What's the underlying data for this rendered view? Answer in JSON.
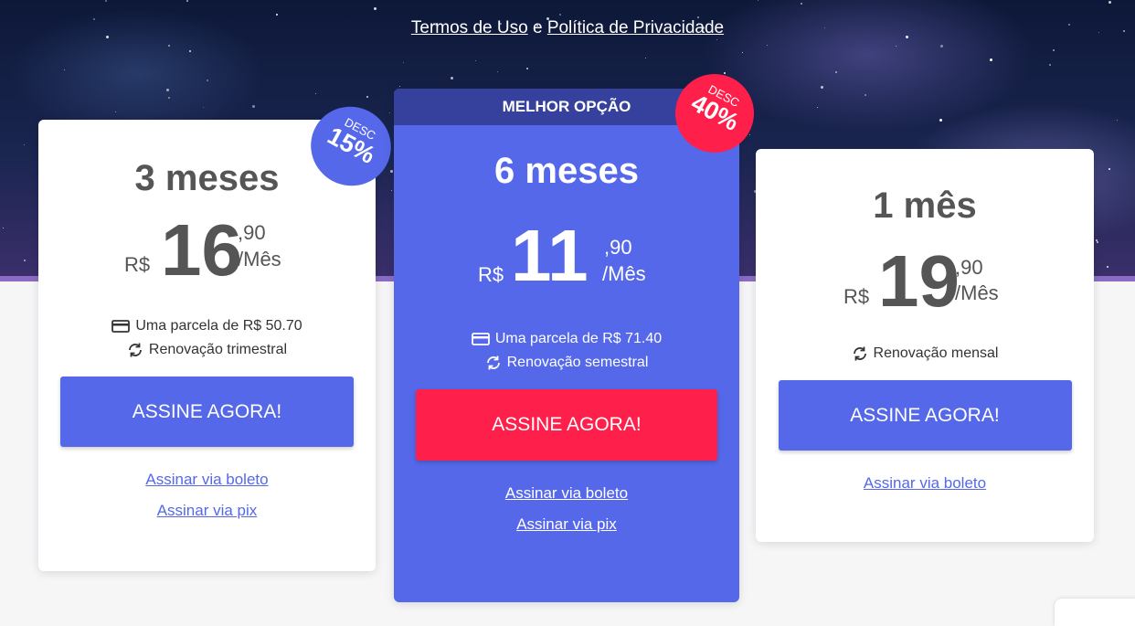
{
  "terms": {
    "terms_link": "Termos de Uso",
    "and": "e",
    "privacy_link": "Política de Privacidade"
  },
  "plans": [
    {
      "months": "3 meses",
      "currency": "R$",
      "integer": "16",
      "cents": ",90",
      "per": "/Mês",
      "installment": "Uma parcela de R$ 50.70",
      "renewal": "Renovação trimestral",
      "cta": "ASSINE AGORA!",
      "boleto": "Assinar via boleto",
      "pix": "Assinar via pix",
      "badge_label": "DESC",
      "badge_percent": "15%"
    },
    {
      "ribbon": "MELHOR OPÇÃO",
      "months": "6 meses",
      "currency": "R$",
      "integer": "11",
      "cents": ",90",
      "per": "/Mês",
      "installment": "Uma parcela de R$ 71.40",
      "renewal": "Renovação semestral",
      "cta": "ASSINE AGORA!",
      "boleto": "Assinar via boleto",
      "pix": "Assinar via pix",
      "badge_label": "DESC",
      "badge_percent": "40%"
    },
    {
      "months": "1 mês",
      "currency": "R$",
      "integer": "19",
      "cents": ",90",
      "per": "/Mês",
      "renewal": "Renovação mensal",
      "cta": "ASSINE AGORA!",
      "boleto": "Assinar via boleto"
    }
  ],
  "colors": {
    "primary": "#5468e9",
    "accent": "#ff1f4b",
    "ribbon": "#35419c"
  },
  "icons": {
    "installment": "credit-card-icon",
    "renewal": "refresh-icon"
  }
}
